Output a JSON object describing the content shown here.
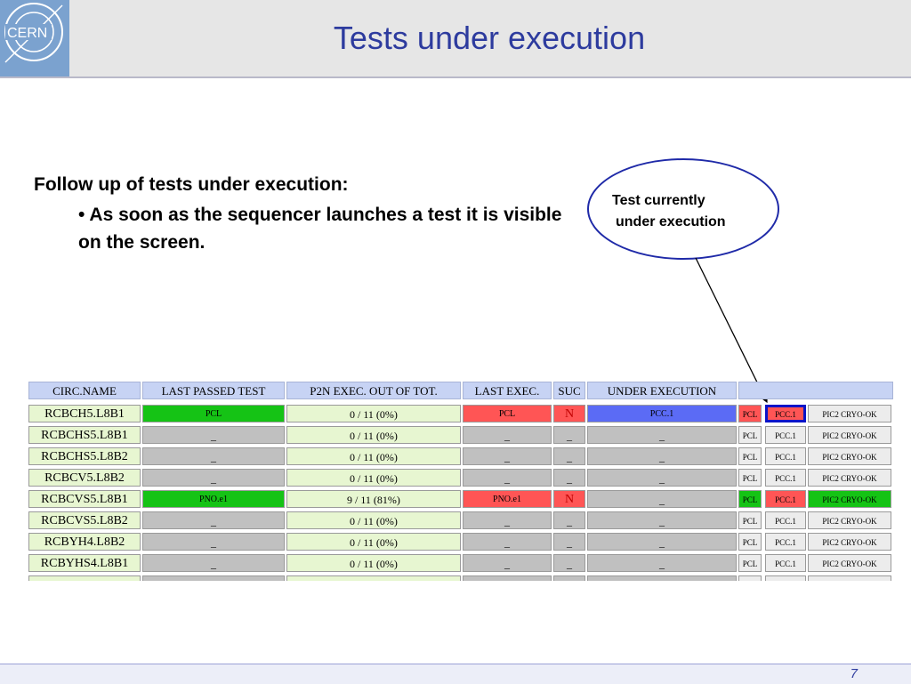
{
  "header": {
    "logo_text": "CERN",
    "title": "Tests under execution"
  },
  "body": {
    "heading": "Follow up of tests under execution:",
    "bullet": "• As soon as the sequencer launches a test it is visible on the screen."
  },
  "callout": {
    "line1": "Test currently",
    "line2": "under execution"
  },
  "table": {
    "headers": [
      "CIRC.NAME",
      "LAST PASSED TEST",
      "P2N EXEC. OUT OF TOT.",
      "LAST EXEC.",
      "SUC",
      "UNDER EXECUTION",
      ""
    ],
    "rows": [
      {
        "name": "RCBCH5.L8B1",
        "passed": "PCL",
        "p2n": "0 / 11 (0%)",
        "last": "PCL",
        "suc": "N",
        "under": "PCC.1",
        "s1": "PCL",
        "s2": "PCC.1",
        "s3": "PIC2 CRYO-OK"
      },
      {
        "name": "RCBCHS5.L8B1",
        "passed": "_",
        "p2n": "0 / 11 (0%)",
        "last": "_",
        "suc": "_",
        "under": "_",
        "s1": "PCL",
        "s2": "PCC.1",
        "s3": "PIC2 CRYO-OK"
      },
      {
        "name": "RCBCHS5.L8B2",
        "passed": "_",
        "p2n": "0 / 11 (0%)",
        "last": "_",
        "suc": "_",
        "under": "_",
        "s1": "PCL",
        "s2": "PCC.1",
        "s3": "PIC2 CRYO-OK"
      },
      {
        "name": "RCBCV5.L8B2",
        "passed": "_",
        "p2n": "0 / 11 (0%)",
        "last": "_",
        "suc": "_",
        "under": "_",
        "s1": "PCL",
        "s2": "PCC.1",
        "s3": "PIC2 CRYO-OK"
      },
      {
        "name": "RCBCVS5.L8B1",
        "passed": "PNO.e1",
        "p2n": "9 / 11 (81%)",
        "last": "PNO.e1",
        "suc": "N",
        "under": "_",
        "s1": "PCL",
        "s2": "PCC.1",
        "s3": "PIC2 CRYO-OK"
      },
      {
        "name": "RCBCVS5.L8B2",
        "passed": "_",
        "p2n": "0 / 11 (0%)",
        "last": "_",
        "suc": "_",
        "under": "_",
        "s1": "PCL",
        "s2": "PCC.1",
        "s3": "PIC2 CRYO-OK"
      },
      {
        "name": "RCBYH4.L8B2",
        "passed": "_",
        "p2n": "0 / 11 (0%)",
        "last": "_",
        "suc": "_",
        "under": "_",
        "s1": "PCL",
        "s2": "PCC.1",
        "s3": "PIC2 CRYO-OK"
      },
      {
        "name": "RCBYHS4.L8B1",
        "passed": "_",
        "p2n": "0 / 11 (0%)",
        "last": "_",
        "suc": "_",
        "under": "_",
        "s1": "PCL",
        "s2": "PCC.1",
        "s3": "PIC2 CRYO-OK"
      }
    ]
  },
  "footer": {
    "page_number": "7"
  },
  "colors": {
    "title": "#2d3b9e",
    "passed_green": "#15c315",
    "failed_red": "#ff5555",
    "running_blue": "#5b6bf5",
    "callout_border": "#1f2aa8"
  }
}
